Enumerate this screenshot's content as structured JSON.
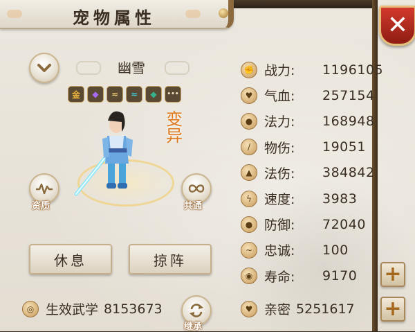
{
  "window": {
    "title": "宠物属性",
    "close_glyph": "✕"
  },
  "pet": {
    "name": "幽雪",
    "transform_label": "变异",
    "skill_chips": [
      {
        "icon": "gold-coin-icon",
        "glyph": "金",
        "color": "#e9b43b"
      },
      {
        "icon": "purple-drop-icon",
        "glyph": "◆",
        "color": "#8b4fd6"
      },
      {
        "icon": "wind-swirl-icon",
        "glyph": "≈",
        "color": "#e7c873"
      },
      {
        "icon": "cyan-swirl-icon",
        "glyph": "≈",
        "color": "#3fc6d8"
      },
      {
        "icon": "jade-gem-icon",
        "glyph": "◆",
        "color": "#36b38c"
      },
      {
        "icon": "more-icon",
        "glyph": "•••",
        "color": "#f0e2c0"
      }
    ]
  },
  "buttons": {
    "aptitude": "资质",
    "shared": "共通",
    "rest": "休息",
    "deploy": "掠阵",
    "inherit": "继承"
  },
  "bottom": {
    "martial_label": "生效武学",
    "martial_value": "8153673",
    "intimacy_label": "亲密",
    "intimacy_value": "5251617"
  },
  "stats": [
    {
      "icon": "fist-icon",
      "label": "战力:",
      "value": "1196105"
    },
    {
      "icon": "heart-icon",
      "label": "气血:",
      "value": "257154"
    },
    {
      "icon": "water-drop-icon",
      "label": "法力:",
      "value": "168948"
    },
    {
      "icon": "sword-icon",
      "label": "物伤:",
      "value": "19051"
    },
    {
      "icon": "flame-icon",
      "label": "法伤:",
      "value": "384842"
    },
    {
      "icon": "lightning-icon",
      "label": "速度:",
      "value": "3983"
    },
    {
      "icon": "shield-icon",
      "label": "防御:",
      "value": "72040"
    },
    {
      "icon": "loyalty-wave-icon",
      "label": "忠诚:",
      "value": "100"
    },
    {
      "icon": "lifespan-icon",
      "label": "寿命:",
      "value": "9170"
    }
  ],
  "colors": {
    "accent": "#e07a1e",
    "close_red": "#c4301f",
    "panel": "#e9e4da"
  }
}
